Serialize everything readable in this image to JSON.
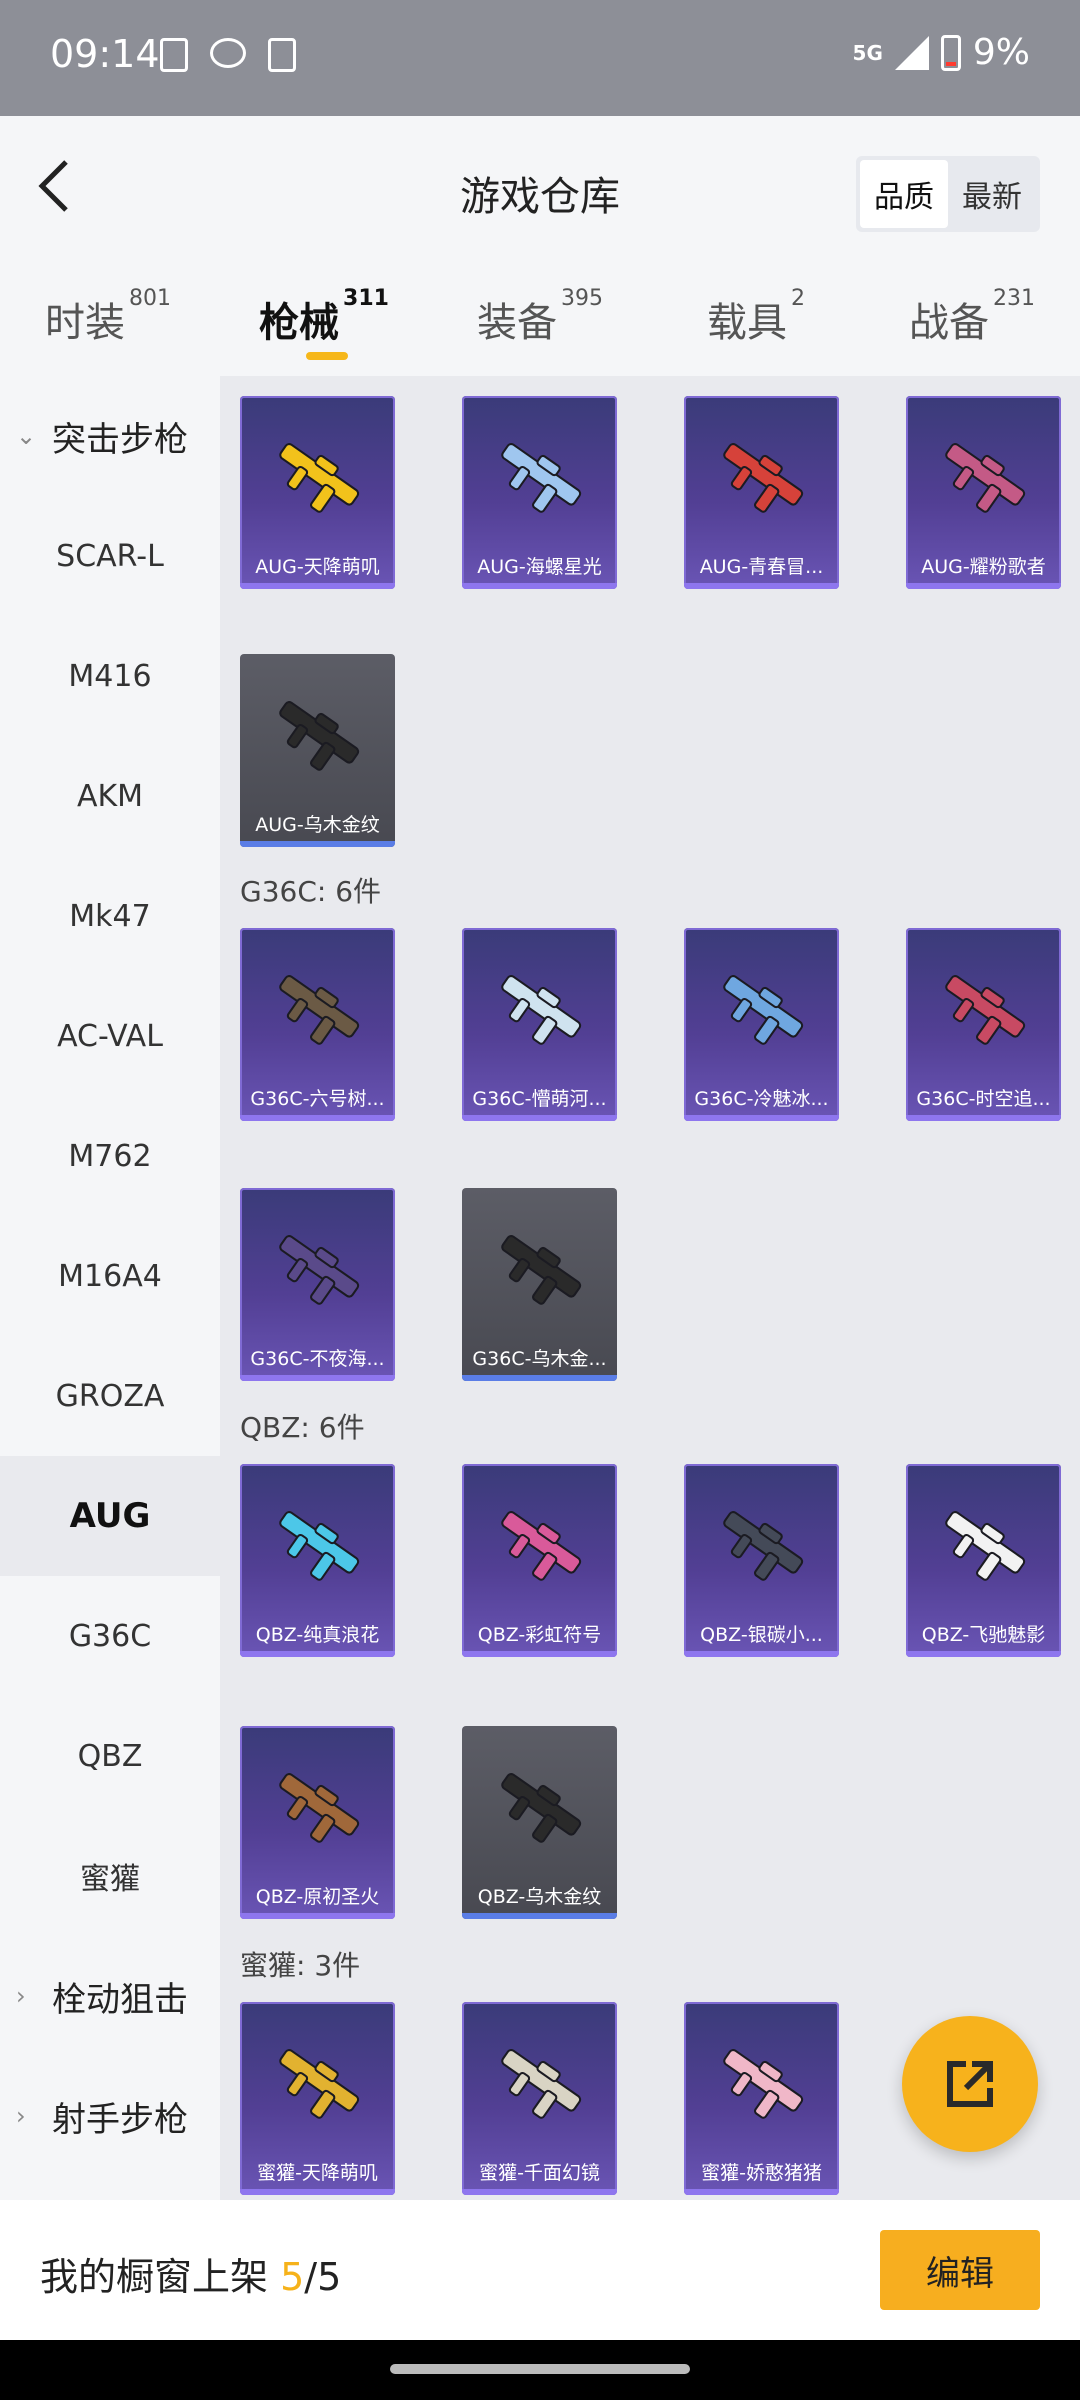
{
  "status": {
    "time": "09:14",
    "network": "5G",
    "battery": "9%"
  },
  "header": {
    "title": "游戏仓库",
    "sort_options": [
      "品质",
      "最新"
    ],
    "sort_active": 0
  },
  "tabs": [
    {
      "label": "时装",
      "count": "801"
    },
    {
      "label": "枪械",
      "count": "311"
    },
    {
      "label": "装备",
      "count": "395"
    },
    {
      "label": "载具",
      "count": "2"
    },
    {
      "label": "战备",
      "count": "231"
    }
  ],
  "sidebar": {
    "category_open": "突击步枪",
    "items": [
      "SCAR-L",
      "M416",
      "AKM",
      "Mk47",
      "AC-VAL",
      "M762",
      "M16A4",
      "GROZA",
      "AUG",
      "G36C",
      "QBZ",
      "蜜獾"
    ],
    "active": "AUG",
    "collapsed": [
      "栓动狙击",
      "射手步枪"
    ]
  },
  "sections": {
    "aug_cards": [
      "AUG-天降萌叽",
      "AUG-海螺星光",
      "AUG-青春冒...",
      "AUG-耀粉歌者",
      "AUG-乌木金纹"
    ],
    "g36c_title": "G36C: 6件",
    "g36c_cards": [
      "G36C-六号树...",
      "G36C-懵萌河...",
      "G36C-冷魅冰...",
      "G36C-时空追...",
      "G36C-不夜海...",
      "G36C-乌木金..."
    ],
    "qbz_title": "QBZ: 6件",
    "qbz_cards": [
      "QBZ-纯真浪花",
      "QBZ-彩虹符号",
      "QBZ-银碳小...",
      "QBZ-飞驰魅影",
      "QBZ-原初圣火",
      "QBZ-乌木金纹"
    ],
    "mihuan_title": "蜜獾: 3件",
    "mihuan_cards": [
      "蜜獾-天降萌叽",
      "蜜獾-千面幻镜",
      "蜜獾-娇憨猪猪"
    ]
  },
  "gun_colors": {
    "aug": [
      "#f2c21b",
      "#9fc6ef",
      "#d6423a",
      "#c45a86",
      "#2a2a2a"
    ],
    "g36c": [
      "#6b5a45",
      "#cfe3ef",
      "#6fa7e0",
      "#c84a63",
      "#5a4a8a",
      "#2a2a2a"
    ],
    "qbz": [
      "#4cc7e8",
      "#d95a9a",
      "#444a58",
      "#f2f2f2",
      "#a0683a",
      "#2a2a2a"
    ],
    "mihuan": [
      "#e2b230",
      "#d9d4c4",
      "#f0b7c8"
    ]
  },
  "bottom": {
    "text_prefix": "我的橱窗上架 ",
    "current": "5",
    "slash_total": "/5",
    "edit_label": "编辑"
  },
  "fab_icon": "external-link-icon",
  "back_icon": "back-arrow-icon"
}
